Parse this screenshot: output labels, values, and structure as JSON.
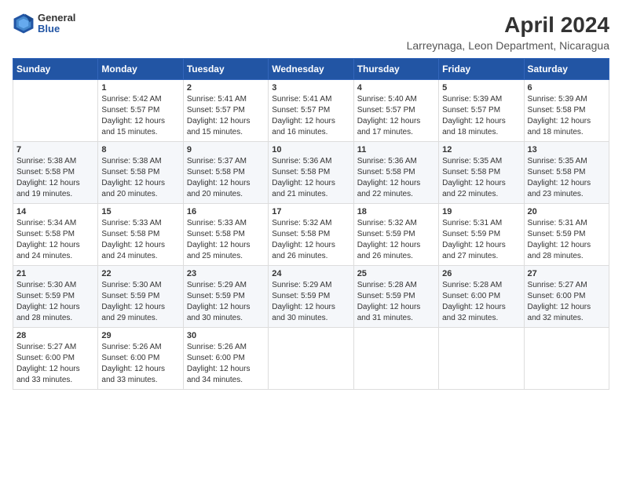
{
  "header": {
    "logo_general": "General",
    "logo_blue": "Blue",
    "month_title": "April 2024",
    "location": "Larreynaga, Leon Department, Nicaragua"
  },
  "weekdays": [
    "Sunday",
    "Monday",
    "Tuesday",
    "Wednesday",
    "Thursday",
    "Friday",
    "Saturday"
  ],
  "weeks": [
    [
      {
        "day": "",
        "sunrise": "",
        "sunset": "",
        "daylight": "",
        "empty": true
      },
      {
        "day": "1",
        "sunrise": "Sunrise: 5:42 AM",
        "sunset": "Sunset: 5:57 PM",
        "daylight": "Daylight: 12 hours and 15 minutes."
      },
      {
        "day": "2",
        "sunrise": "Sunrise: 5:41 AM",
        "sunset": "Sunset: 5:57 PM",
        "daylight": "Daylight: 12 hours and 15 minutes."
      },
      {
        "day": "3",
        "sunrise": "Sunrise: 5:41 AM",
        "sunset": "Sunset: 5:57 PM",
        "daylight": "Daylight: 12 hours and 16 minutes."
      },
      {
        "day": "4",
        "sunrise": "Sunrise: 5:40 AM",
        "sunset": "Sunset: 5:57 PM",
        "daylight": "Daylight: 12 hours and 17 minutes."
      },
      {
        "day": "5",
        "sunrise": "Sunrise: 5:39 AM",
        "sunset": "Sunset: 5:57 PM",
        "daylight": "Daylight: 12 hours and 18 minutes."
      },
      {
        "day": "6",
        "sunrise": "Sunrise: 5:39 AM",
        "sunset": "Sunset: 5:58 PM",
        "daylight": "Daylight: 12 hours and 18 minutes."
      }
    ],
    [
      {
        "day": "7",
        "sunrise": "Sunrise: 5:38 AM",
        "sunset": "Sunset: 5:58 PM",
        "daylight": "Daylight: 12 hours and 19 minutes."
      },
      {
        "day": "8",
        "sunrise": "Sunrise: 5:38 AM",
        "sunset": "Sunset: 5:58 PM",
        "daylight": "Daylight: 12 hours and 20 minutes."
      },
      {
        "day": "9",
        "sunrise": "Sunrise: 5:37 AM",
        "sunset": "Sunset: 5:58 PM",
        "daylight": "Daylight: 12 hours and 20 minutes."
      },
      {
        "day": "10",
        "sunrise": "Sunrise: 5:36 AM",
        "sunset": "Sunset: 5:58 PM",
        "daylight": "Daylight: 12 hours and 21 minutes."
      },
      {
        "day": "11",
        "sunrise": "Sunrise: 5:36 AM",
        "sunset": "Sunset: 5:58 PM",
        "daylight": "Daylight: 12 hours and 22 minutes."
      },
      {
        "day": "12",
        "sunrise": "Sunrise: 5:35 AM",
        "sunset": "Sunset: 5:58 PM",
        "daylight": "Daylight: 12 hours and 22 minutes."
      },
      {
        "day": "13",
        "sunrise": "Sunrise: 5:35 AM",
        "sunset": "Sunset: 5:58 PM",
        "daylight": "Daylight: 12 hours and 23 minutes."
      }
    ],
    [
      {
        "day": "14",
        "sunrise": "Sunrise: 5:34 AM",
        "sunset": "Sunset: 5:58 PM",
        "daylight": "Daylight: 12 hours and 24 minutes."
      },
      {
        "day": "15",
        "sunrise": "Sunrise: 5:33 AM",
        "sunset": "Sunset: 5:58 PM",
        "daylight": "Daylight: 12 hours and 24 minutes."
      },
      {
        "day": "16",
        "sunrise": "Sunrise: 5:33 AM",
        "sunset": "Sunset: 5:58 PM",
        "daylight": "Daylight: 12 hours and 25 minutes."
      },
      {
        "day": "17",
        "sunrise": "Sunrise: 5:32 AM",
        "sunset": "Sunset: 5:58 PM",
        "daylight": "Daylight: 12 hours and 26 minutes."
      },
      {
        "day": "18",
        "sunrise": "Sunrise: 5:32 AM",
        "sunset": "Sunset: 5:59 PM",
        "daylight": "Daylight: 12 hours and 26 minutes."
      },
      {
        "day": "19",
        "sunrise": "Sunrise: 5:31 AM",
        "sunset": "Sunset: 5:59 PM",
        "daylight": "Daylight: 12 hours and 27 minutes."
      },
      {
        "day": "20",
        "sunrise": "Sunrise: 5:31 AM",
        "sunset": "Sunset: 5:59 PM",
        "daylight": "Daylight: 12 hours and 28 minutes."
      }
    ],
    [
      {
        "day": "21",
        "sunrise": "Sunrise: 5:30 AM",
        "sunset": "Sunset: 5:59 PM",
        "daylight": "Daylight: 12 hours and 28 minutes."
      },
      {
        "day": "22",
        "sunrise": "Sunrise: 5:30 AM",
        "sunset": "Sunset: 5:59 PM",
        "daylight": "Daylight: 12 hours and 29 minutes."
      },
      {
        "day": "23",
        "sunrise": "Sunrise: 5:29 AM",
        "sunset": "Sunset: 5:59 PM",
        "daylight": "Daylight: 12 hours and 30 minutes."
      },
      {
        "day": "24",
        "sunrise": "Sunrise: 5:29 AM",
        "sunset": "Sunset: 5:59 PM",
        "daylight": "Daylight: 12 hours and 30 minutes."
      },
      {
        "day": "25",
        "sunrise": "Sunrise: 5:28 AM",
        "sunset": "Sunset: 5:59 PM",
        "daylight": "Daylight: 12 hours and 31 minutes."
      },
      {
        "day": "26",
        "sunrise": "Sunrise: 5:28 AM",
        "sunset": "Sunset: 6:00 PM",
        "daylight": "Daylight: 12 hours and 32 minutes."
      },
      {
        "day": "27",
        "sunrise": "Sunrise: 5:27 AM",
        "sunset": "Sunset: 6:00 PM",
        "daylight": "Daylight: 12 hours and 32 minutes."
      }
    ],
    [
      {
        "day": "28",
        "sunrise": "Sunrise: 5:27 AM",
        "sunset": "Sunset: 6:00 PM",
        "daylight": "Daylight: 12 hours and 33 minutes."
      },
      {
        "day": "29",
        "sunrise": "Sunrise: 5:26 AM",
        "sunset": "Sunset: 6:00 PM",
        "daylight": "Daylight: 12 hours and 33 minutes."
      },
      {
        "day": "30",
        "sunrise": "Sunrise: 5:26 AM",
        "sunset": "Sunset: 6:00 PM",
        "daylight": "Daylight: 12 hours and 34 minutes."
      },
      {
        "day": "",
        "sunrise": "",
        "sunset": "",
        "daylight": "",
        "empty": true
      },
      {
        "day": "",
        "sunrise": "",
        "sunset": "",
        "daylight": "",
        "empty": true
      },
      {
        "day": "",
        "sunrise": "",
        "sunset": "",
        "daylight": "",
        "empty": true
      },
      {
        "day": "",
        "sunrise": "",
        "sunset": "",
        "daylight": "",
        "empty": true
      }
    ]
  ]
}
